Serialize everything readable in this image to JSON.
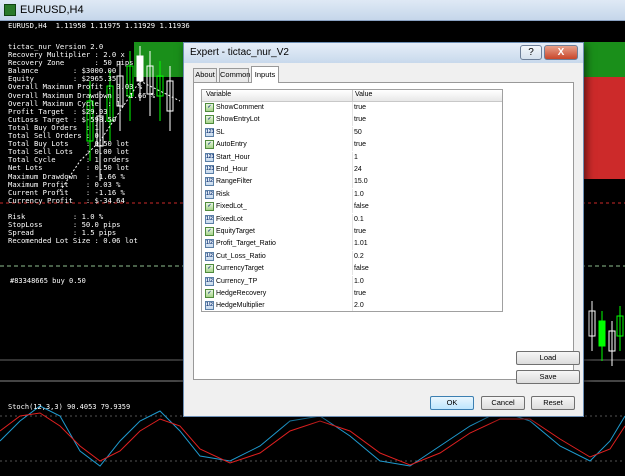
{
  "chart_window": {
    "title": "EURUSD,H4",
    "quote": "EURUSD,H4  1.11958 1.11975 1.11929 1.11936"
  },
  "ea_info": {
    "lines": [
      "tictac_nur Version 2.0",
      "Recovery Multiplier : 2.0 x",
      "Recovery Zone       : 50 pips",
      "Balance        : $3000.00",
      "Equity         : $2965.35",
      "Overall Maximum Profit : 0.03 %",
      "Overall Maximum Drawdown : -1.66 %",
      "Overall Maximum Cycle  : 1",
      "Profit Target  : $29.93",
      "CutLoss Target : $-598.50",
      "Total Buy Orders  : 1",
      "Total Sell Orders : 0",
      "Total Buy Lots    : 0.50 lot",
      "Total Sell Lots   : 0.00 lot",
      "Total Cycle       : 1 orders",
      "Net Lots          : 0.50 lot",
      "Maximum Drawdown  : -1.66 %",
      "Maximum Profit    : 0.03 %",
      "Current Profit    : -1.16 %",
      "Currency Profit   : $-34.64",
      "",
      "Risk           : 1.0 %",
      "StopLoss       : 50.0 pips",
      "Spread         : 1.5 pips",
      "Recomended Lot Size : 0.06 lot"
    ],
    "trade_label": "#83348665 buy 0.50",
    "stoch_label": "Stoch(12,3,3) 90.4053 79.9359"
  },
  "dialog": {
    "title": "Expert - tictac_nur_V2",
    "help_label": "?",
    "close_label": "X",
    "tabs": [
      {
        "label": "About",
        "active": false
      },
      {
        "label": "Common",
        "active": false
      },
      {
        "label": "Inputs",
        "active": true
      }
    ],
    "columns": {
      "variable": "Variable",
      "value": "Value"
    },
    "inputs": [
      {
        "icon": "bool-icon",
        "name": "ShowComment",
        "value": "true"
      },
      {
        "icon": "bool-icon",
        "name": "ShowEntryLot",
        "value": "true"
      },
      {
        "icon": "int-icon",
        "name": "SL",
        "value": "50"
      },
      {
        "icon": "bool-icon",
        "name": "AutoEntry",
        "value": "true"
      },
      {
        "icon": "int-icon",
        "name": "Start_Hour",
        "value": "1"
      },
      {
        "icon": "int-icon",
        "name": "End_Hour",
        "value": "24"
      },
      {
        "icon": "double-icon",
        "name": "RangeFilter",
        "value": "15.0"
      },
      {
        "icon": "double-icon",
        "name": "Risk",
        "value": "1.0"
      },
      {
        "icon": "bool-icon",
        "name": "FixedLot_",
        "value": "false"
      },
      {
        "icon": "double-icon",
        "name": "FixedLot",
        "value": "0.1"
      },
      {
        "icon": "bool-icon",
        "name": "EquityTarget",
        "value": "true"
      },
      {
        "icon": "double-icon",
        "name": "Profit_Target_Ratio",
        "value": "1.01"
      },
      {
        "icon": "double-icon",
        "name": "Cut_Loss_Ratio",
        "value": "0.2"
      },
      {
        "icon": "bool-icon",
        "name": "CurrencyTarget",
        "value": "false"
      },
      {
        "icon": "double-icon",
        "name": "Currency_TP",
        "value": "1.0"
      },
      {
        "icon": "bool-icon",
        "name": "HedgeRecovery",
        "value": "true"
      },
      {
        "icon": "double-icon",
        "name": "HedgeMultiplier",
        "value": "2.0"
      }
    ],
    "buttons": {
      "load": "Load",
      "save": "Save",
      "ok": "OK",
      "cancel": "Cancel",
      "reset": "Reset"
    }
  },
  "colors": {
    "chart_background": "#000000",
    "bull_candle": "#00ff00",
    "bear_candle": "#ffffff",
    "buy_zone": "#1a8f1a",
    "sell_zone": "#cc2a2a",
    "stoch_main": "#1f9bd0",
    "stoch_signal": "#e02020"
  }
}
